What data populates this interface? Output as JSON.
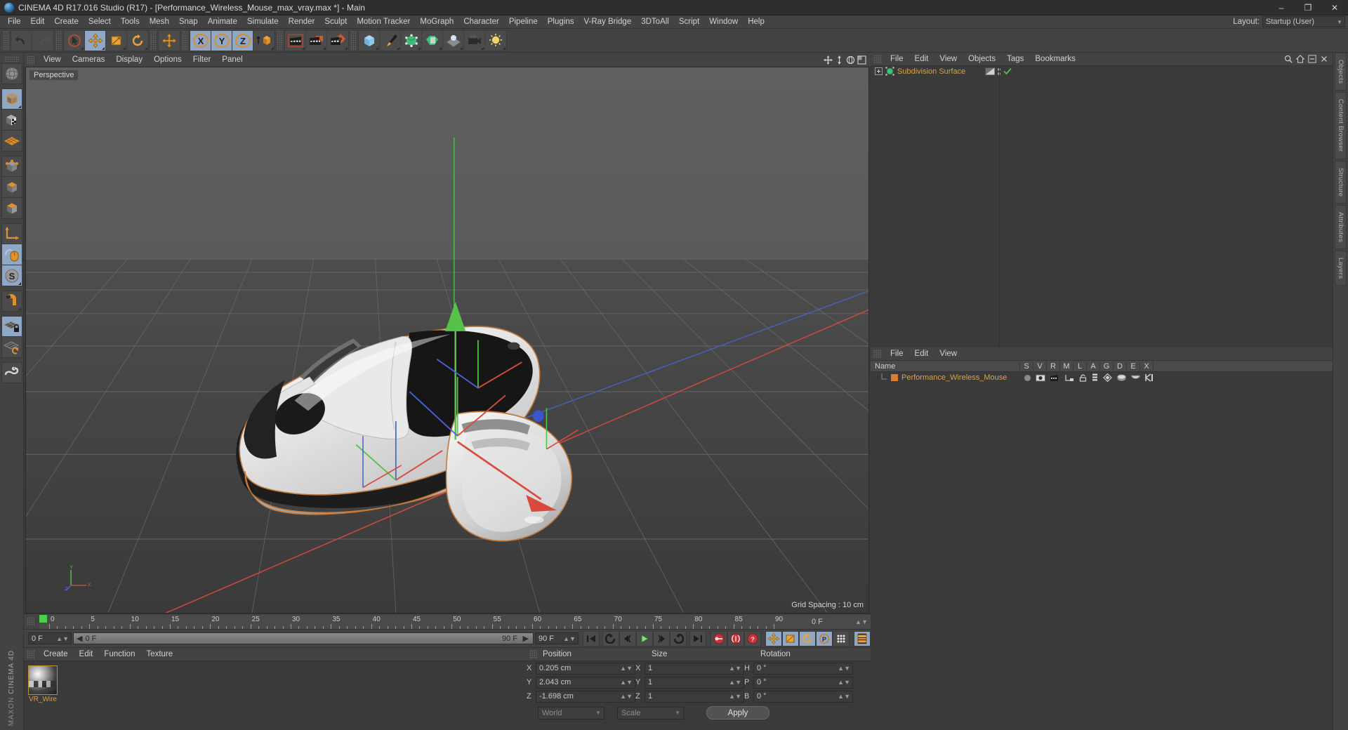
{
  "window": {
    "title": "CINEMA 4D R17.016 Studio (R17) - [Performance_Wireless_Mouse_max_vray.max *] - Main",
    "minimize": "–",
    "maximize": "❐",
    "close": "✕"
  },
  "menubar": {
    "items": [
      "File",
      "Edit",
      "Create",
      "Select",
      "Tools",
      "Mesh",
      "Snap",
      "Animate",
      "Simulate",
      "Render",
      "Sculpt",
      "Motion Tracker",
      "MoGraph",
      "Character",
      "Pipeline",
      "Plugins",
      "V-Ray Bridge",
      "3DToAll",
      "Script",
      "Window",
      "Help"
    ],
    "layout_label": "Layout:",
    "layout_value": "Startup (User)"
  },
  "toolbar": {
    "groups": [
      {
        "name": "history",
        "buttons": [
          {
            "name": "undo-button",
            "icon": "undo",
            "state": "normal"
          },
          {
            "name": "redo-button",
            "icon": "redo",
            "state": "disabled"
          }
        ]
      },
      {
        "name": "transform-tools",
        "buttons": [
          {
            "name": "live-selection-tool",
            "icon": "cursor-circle",
            "state": "normal"
          },
          {
            "name": "move-tool",
            "icon": "move-arrows",
            "state": "active"
          },
          {
            "name": "scale-tool",
            "icon": "scale-box",
            "state": "normal"
          },
          {
            "name": "rotate-tool",
            "icon": "rotate-arc",
            "state": "normal"
          }
        ]
      },
      {
        "name": "global-axis",
        "buttons": [
          {
            "name": "world-coordinates-button",
            "icon": "move-arrows",
            "state": "normal"
          }
        ]
      },
      {
        "name": "axis-locks",
        "buttons": [
          {
            "name": "lock-x-axis-button",
            "icon": "axis-x",
            "state": "active"
          },
          {
            "name": "lock-y-axis-button",
            "icon": "axis-y",
            "state": "active"
          },
          {
            "name": "lock-z-axis-button",
            "icon": "axis-z",
            "state": "active"
          },
          {
            "name": "coordinate-system-button",
            "icon": "world-object-cube",
            "state": "normal"
          }
        ]
      },
      {
        "name": "render-tools",
        "buttons": [
          {
            "name": "render-view-button",
            "icon": "clapper",
            "state": "normal"
          },
          {
            "name": "render-to-picture-viewer-button",
            "icon": "clapper-picture",
            "state": "normal"
          },
          {
            "name": "render-settings-button",
            "icon": "clapper-gear",
            "state": "normal"
          }
        ]
      },
      {
        "name": "create-objects",
        "buttons": [
          {
            "name": "add-primitive-cube-button",
            "icon": "blue-cube",
            "state": "normal"
          },
          {
            "name": "add-spline-pen-button",
            "icon": "pen-nib",
            "state": "normal"
          },
          {
            "name": "add-generator-button",
            "icon": "green-nurbs",
            "state": "normal"
          },
          {
            "name": "add-deformer-button",
            "icon": "green-deformer",
            "state": "normal"
          },
          {
            "name": "add-environment-button",
            "icon": "floor-env",
            "state": "normal"
          },
          {
            "name": "add-camera-button",
            "icon": "camera",
            "state": "normal"
          },
          {
            "name": "add-light-button",
            "icon": "light-bulb",
            "state": "normal"
          }
        ]
      }
    ]
  },
  "leftbar": {
    "buttons": [
      {
        "name": "undo-view-button",
        "icon": "globe-sphere",
        "state": "normal"
      },
      {
        "name": "model-mode-button",
        "icon": "gray-cube-orange-outline",
        "state": "active"
      },
      {
        "name": "texture-mode-button",
        "icon": "checker-cube",
        "state": "normal"
      },
      {
        "name": "polygon-grid-button",
        "icon": "orange-grid",
        "state": "normal"
      },
      {
        "name": "point-mode-button",
        "icon": "cube-points",
        "state": "normal"
      },
      {
        "name": "edge-mode-button",
        "icon": "cube-edges",
        "state": "normal"
      },
      {
        "name": "polygon-mode-button",
        "icon": "cube-polygon",
        "state": "normal"
      },
      {
        "name": "axis-mode-button",
        "icon": "orange-axis",
        "state": "normal"
      },
      {
        "name": "enable-axis-button",
        "icon": "mouse-axis",
        "state": "active"
      },
      {
        "name": "soft-selection-button",
        "icon": "s-sphere",
        "state": "active"
      },
      {
        "name": "magnet-button",
        "icon": "magnet",
        "state": "normal"
      },
      {
        "name": "lock-workplane-button",
        "icon": "grid-lock",
        "state": "active"
      },
      {
        "name": "workplane-button",
        "icon": "grid-rotate",
        "state": "normal"
      },
      {
        "name": "python-button",
        "icon": "python-snake",
        "state": "normal"
      }
    ],
    "brand_line1": "MAXON",
    "brand_line2": "CINEMA 4D"
  },
  "viewport": {
    "menu": [
      "View",
      "Cameras",
      "Display",
      "Options",
      "Filter",
      "Panel"
    ],
    "label": "Perspective",
    "grid_spacing": "Grid Spacing : 10 cm",
    "axis_labels": {
      "y": "Y",
      "x": "X",
      "z": "Z"
    },
    "model_name": "Performance Wireless Mouse"
  },
  "timeline": {
    "ticks": [
      "0",
      "5",
      "10",
      "15",
      "20",
      "25",
      "30",
      "35",
      "40",
      "45",
      "50",
      "55",
      "60",
      "65",
      "70",
      "75",
      "80",
      "85",
      "90"
    ],
    "end_display": "0 F",
    "current_frame": "0 F",
    "slider_value": "0 F",
    "range_end_label": "90 F",
    "preview_end": "90 F"
  },
  "transport": {
    "buttons": [
      {
        "name": "go-to-start-button",
        "icon": "skip-start"
      },
      {
        "name": "previous-key-button",
        "icon": "prev-key"
      },
      {
        "name": "step-back-button",
        "icon": "step-back"
      },
      {
        "name": "play-button",
        "icon": "play"
      },
      {
        "name": "step-forward-button",
        "icon": "step-forward"
      },
      {
        "name": "next-key-button",
        "icon": "next-key"
      },
      {
        "name": "go-to-end-button",
        "icon": "skip-end"
      },
      {
        "name": "record-active-objects-button",
        "icon": "record-key"
      },
      {
        "name": "autokeying-button",
        "icon": "auto-key"
      },
      {
        "name": "keyframe-selection-button",
        "icon": "key-question"
      },
      {
        "name": "position-key-button",
        "icon": "move-arrows"
      },
      {
        "name": "scale-key-button",
        "icon": "scale-box"
      },
      {
        "name": "rotation-key-button",
        "icon": "rotate-arc"
      },
      {
        "name": "parameter-key-button",
        "icon": "p-circle"
      },
      {
        "name": "point-level-animation-button",
        "icon": "pla-dots"
      },
      {
        "name": "timeline-button",
        "icon": "film-strip"
      }
    ]
  },
  "material_manager": {
    "menu": [
      "Create",
      "Edit",
      "Function",
      "Texture"
    ],
    "materials": [
      {
        "name": "VR_Wire"
      }
    ]
  },
  "coordinates": {
    "headers": [
      "Position",
      "Size",
      "Rotation"
    ],
    "rows": [
      {
        "pos_axis": "X",
        "pos_value": "0.205 cm",
        "size_axis": "X",
        "size_value": "1",
        "rot_axis": "H",
        "rot_value": "0 °"
      },
      {
        "pos_axis": "Y",
        "pos_value": "2.043 cm",
        "size_axis": "Y",
        "size_value": "1",
        "rot_axis": "P",
        "rot_value": "0 °"
      },
      {
        "pos_axis": "Z",
        "pos_value": "-1.698 cm",
        "size_axis": "Z",
        "size_value": "1",
        "rot_axis": "B",
        "rot_value": "0 °"
      }
    ],
    "coord_system": "World",
    "transform_mode": "Scale",
    "apply_label": "Apply"
  },
  "object_manager": {
    "menu": [
      "File",
      "Edit",
      "View",
      "Objects",
      "Tags",
      "Bookmarks"
    ],
    "items": [
      {
        "name": "Subdivision Surface",
        "expandable": true,
        "visible_check": true
      }
    ]
  },
  "attribute_manager": {
    "menu": [
      "File",
      "Edit",
      "View"
    ],
    "columns": [
      "Name",
      "S",
      "V",
      "R",
      "M",
      "L",
      "A",
      "G",
      "D",
      "E",
      "X"
    ],
    "rows": [
      {
        "name": "Performance_Wireless_Mouse",
        "color": "#e07b2a"
      }
    ]
  },
  "right_rail": {
    "tabs": [
      "Objects",
      "Content Browser",
      "Structure",
      "Attributes",
      "Layers"
    ]
  },
  "colors": {
    "accent_orange": "#d8a24b",
    "active_blue": "#8fa8c8",
    "panel_bg": "#3a3a3a",
    "toolbar_bg": "#434343",
    "button_bg": "#4b4b4b",
    "axis_red": "#d84a3c",
    "axis_green": "#56c24a",
    "axis_blue": "#4a63d8"
  }
}
